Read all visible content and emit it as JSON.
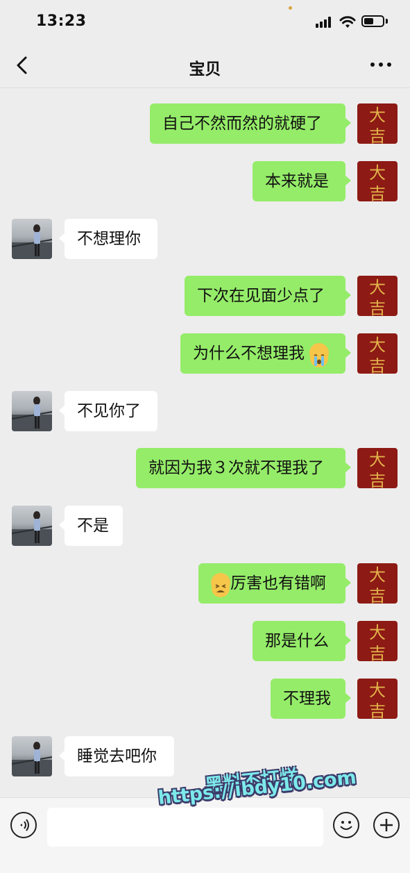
{
  "status_bar": {
    "time": "13:23"
  },
  "nav": {
    "title": "宝贝",
    "back_icon": "chevron-left-icon",
    "more_icon": "ellipsis-icon"
  },
  "self_avatar": {
    "chars": [
      "大",
      "吉"
    ],
    "bg_color": "#8d1a14",
    "text_color": "#e2b24b"
  },
  "messages": [
    {
      "side": "right",
      "text": "自己不然而然的就硬了"
    },
    {
      "side": "right",
      "text": "本来就是"
    },
    {
      "side": "left",
      "text": "不想理你"
    },
    {
      "side": "right",
      "text": "下次在见面少点了"
    },
    {
      "side": "right",
      "text": "为什么不想理我",
      "emoji_after": "crying-face-emoji"
    },
    {
      "side": "left",
      "text": "不见你了"
    },
    {
      "side": "right",
      "text": "就因为我３次就不理我了"
    },
    {
      "side": "left",
      "text": "不是"
    },
    {
      "side": "right",
      "text": "厉害也有错啊",
      "emoji_before": "tired-face-emoji"
    },
    {
      "side": "right",
      "text": "那是什么"
    },
    {
      "side": "right",
      "text": "不理我"
    },
    {
      "side": "left",
      "text": "睡觉去吧你"
    }
  ],
  "input_bar": {
    "voice_icon": "voice-icon",
    "emoji_icon": "smiley-icon",
    "plus_icon": "plus-icon"
  },
  "watermark": {
    "line1": "黑料不打烊",
    "line2": "https://ibdy10.com"
  },
  "colors": {
    "background": "#ededed",
    "self_bubble": "#95ec69",
    "other_bubble": "#ffffff"
  }
}
